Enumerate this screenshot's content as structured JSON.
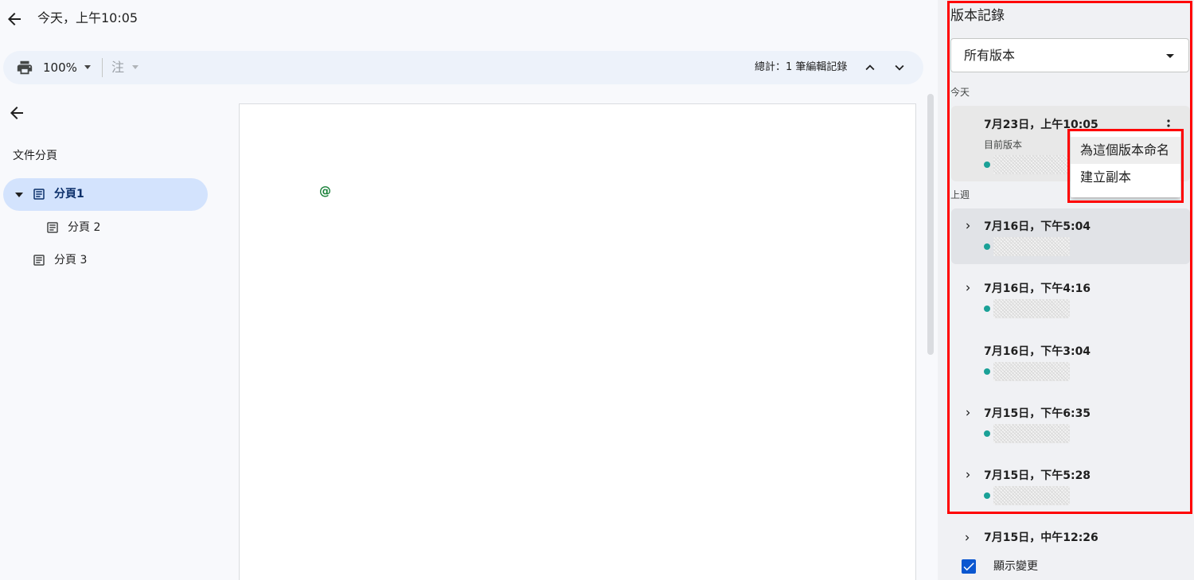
{
  "header": {
    "title": "今天，上午10:05"
  },
  "toolbar": {
    "zoom": "100%",
    "note_label": "注",
    "total_label": "總計：1 筆編輯記錄"
  },
  "outline": {
    "title": "文件分頁",
    "tabs": [
      {
        "label": "分頁1",
        "active": true,
        "expanded": true
      },
      {
        "label": "分頁 2",
        "active": false
      },
      {
        "label": "分頁 3",
        "active": false
      }
    ]
  },
  "document": {
    "content_symbol": "@"
  },
  "history": {
    "title": "版本記錄",
    "filter": "所有版本",
    "sections": {
      "today": "今天",
      "last_week": "上週"
    },
    "versions": [
      {
        "time": "7月23日，上午10:05",
        "subtitle": "目前版本"
      },
      {
        "time": "7月16日，下午5:04"
      },
      {
        "time": "7月16日，下午4:16"
      },
      {
        "time": "7月16日，下午3:04"
      },
      {
        "time": "7月15日，下午6:35"
      },
      {
        "time": "7月15日，下午5:28"
      },
      {
        "time": "7月15日，中午12:26"
      }
    ],
    "context_menu": [
      "為這個版本命名",
      "建立副本"
    ],
    "show_changes_label": "顯示變更",
    "show_changes_checked": true
  },
  "colors": {
    "accent": "#0b57d0",
    "selected_tab_bg": "#d3e3fd",
    "author_dot": "#1aa197",
    "highlight_box": "#ff0000"
  },
  "icons": {
    "back": "arrow-left-icon",
    "print": "print-icon",
    "tab": "document-icon",
    "more": "more-vert-icon",
    "expand": "chevron-right-icon",
    "check": "check-icon"
  }
}
